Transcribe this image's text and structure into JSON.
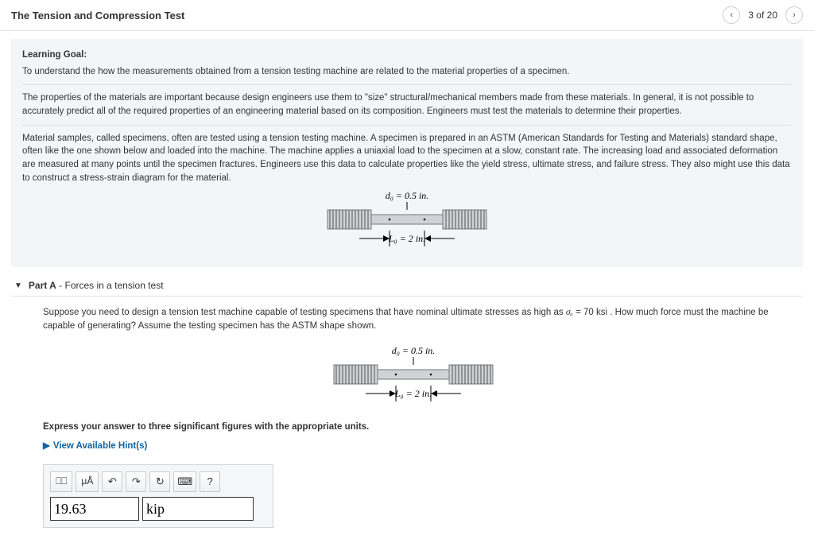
{
  "header": {
    "title": "The Tension and Compression Test",
    "page_text": "3 of 20"
  },
  "goal": {
    "heading": "Learning Goal:",
    "intro": "To understand the how the measurements obtained from a tension testing machine are related to the material properties of a specimen.",
    "p1": "The properties of the materials are important because design engineers use them to \"size\" structural/mechanical members made from these materials. In general, it is not possible to accurately predict all of the required properties of an engineering material based on its composition. Engineers must test the materials to determine their properties.",
    "p2": "Material samples, called specimens, often are tested using a tension testing machine. A specimen is prepared in an ASTM (American Standards for Testing and Materials) standard shape, often like the one shown below and loaded into the machine. The machine applies a uniaxial load to the specimen at a slow, constant rate. The increasing load and associated deformation are measured at many points until the specimen fractures. Engineers use this data to calculate properties like the yield stress, ultimate stress, and failure stress. They also might use this data to construct a stress-strain diagram for the material.",
    "fig": {
      "d0": "d₀ = 0.5 in.",
      "L0": "L₀ = 2 in."
    }
  },
  "partA": {
    "label_part": "Part A",
    "label_sep": " - ",
    "label_title": "Forces in a tension test",
    "q_pre": "Suppose you need to design a tension test machine capable of testing specimens that have nominal ultimate stresses as high as ",
    "sigma": "σᵤ",
    "q_val": " = 70 ksi",
    "q_post": " . How much force must the machine be capable of generating? Assume the testing specimen has the ASTM shape shown.",
    "fig": {
      "d0": "d₀ = 0.5 in.",
      "L0": "L₀ = 2 in."
    },
    "express": "Express your answer to three significant figures with the appropriate units.",
    "hints_label": "View Available Hint(s)",
    "toolbar": {
      "templates": "⎕⎕",
      "units": "μÅ",
      "undo": "↶",
      "redo": "↷",
      "reset": "↻",
      "keyboard": "⌨",
      "help": "?"
    },
    "answer_value": "19.63",
    "answer_unit": "kip"
  }
}
